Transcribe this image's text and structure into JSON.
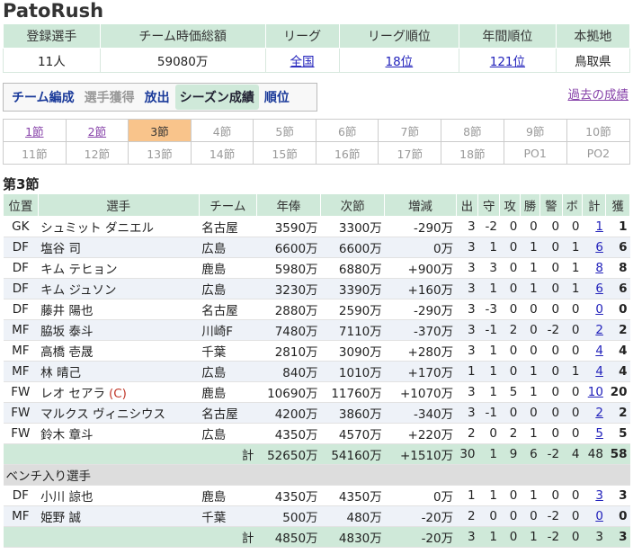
{
  "team_name": "PatoRush",
  "summary": {
    "headers": [
      "登録選手",
      "チーム時価総額",
      "リーグ",
      "リーグ順位",
      "年間順位",
      "本拠地"
    ],
    "values": [
      "11人",
      "59080万",
      "全国",
      "18位",
      "121位",
      "鳥取県"
    ]
  },
  "nav": {
    "items": [
      "チーム編成",
      "選手獲得",
      "放出",
      "シーズン成績",
      "順位"
    ],
    "past_link": "過去の成績"
  },
  "rounds": {
    "row1": [
      "1節",
      "2節",
      "3節",
      "4節",
      "5節",
      "6節",
      "7節",
      "8節",
      "9節",
      "10節"
    ],
    "row2": [
      "11節",
      "12節",
      "13節",
      "14節",
      "15節",
      "16節",
      "17節",
      "18節",
      "PO1",
      "PO2"
    ]
  },
  "section_title": "第3節",
  "table": {
    "headers": [
      "位置",
      "選手",
      "チーム",
      "年俸",
      "次節",
      "増減",
      "出",
      "守",
      "攻",
      "勝",
      "警",
      "ボ",
      "計",
      "獲"
    ],
    "players": [
      {
        "pos": "GK",
        "name": "シュミット ダニエル",
        "cap": "",
        "team": "名古屋",
        "salary": "3590万",
        "next": "3300万",
        "diff": "-290万",
        "de": "3",
        "shu": "-2",
        "kou": "0",
        "sho": "0",
        "kei": "0",
        "bo": "0",
        "kei2": "1",
        "kaku": "1"
      },
      {
        "pos": "DF",
        "name": "塩谷 司",
        "cap": "",
        "team": "広島",
        "salary": "6600万",
        "next": "6600万",
        "diff": "0万",
        "de": "3",
        "shu": "1",
        "kou": "0",
        "sho": "1",
        "kei": "0",
        "bo": "1",
        "kei2": "6",
        "kaku": "6"
      },
      {
        "pos": "DF",
        "name": "キム テヒョン",
        "cap": "",
        "team": "鹿島",
        "salary": "5980万",
        "next": "6880万",
        "diff": "+900万",
        "de": "3",
        "shu": "3",
        "kou": "0",
        "sho": "1",
        "kei": "0",
        "bo": "1",
        "kei2": "8",
        "kaku": "8"
      },
      {
        "pos": "DF",
        "name": "キム ジュソン",
        "cap": "",
        "team": "広島",
        "salary": "3230万",
        "next": "3390万",
        "diff": "+160万",
        "de": "3",
        "shu": "1",
        "kou": "0",
        "sho": "1",
        "kei": "0",
        "bo": "1",
        "kei2": "6",
        "kaku": "6"
      },
      {
        "pos": "DF",
        "name": "藤井 陽也",
        "cap": "",
        "team": "名古屋",
        "salary": "2880万",
        "next": "2590万",
        "diff": "-290万",
        "de": "3",
        "shu": "-3",
        "kou": "0",
        "sho": "0",
        "kei": "0",
        "bo": "0",
        "kei2": "0",
        "kaku": "0"
      },
      {
        "pos": "MF",
        "name": "脇坂 泰斗",
        "cap": "",
        "team": "川崎F",
        "salary": "7480万",
        "next": "7110万",
        "diff": "-370万",
        "de": "3",
        "shu": "-1",
        "kou": "2",
        "sho": "0",
        "kei": "-2",
        "bo": "0",
        "kei2": "2",
        "kaku": "2"
      },
      {
        "pos": "MF",
        "name": "高橋 壱晟",
        "cap": "",
        "team": "千葉",
        "salary": "2810万",
        "next": "3090万",
        "diff": "+280万",
        "de": "3",
        "shu": "1",
        "kou": "0",
        "sho": "0",
        "kei": "0",
        "bo": "0",
        "kei2": "4",
        "kaku": "4"
      },
      {
        "pos": "MF",
        "name": "林 晴己",
        "cap": "",
        "team": "広島",
        "salary": "840万",
        "next": "1010万",
        "diff": "+170万",
        "de": "1",
        "shu": "1",
        "kou": "0",
        "sho": "1",
        "kei": "0",
        "bo": "1",
        "kei2": "4",
        "kaku": "4"
      },
      {
        "pos": "FW",
        "name": "レオ セアラ",
        "cap": "(C)",
        "team": "鹿島",
        "salary": "10690万",
        "next": "11760万",
        "diff": "+1070万",
        "de": "3",
        "shu": "1",
        "kou": "5",
        "sho": "1",
        "kei": "0",
        "bo": "0",
        "kei2": "10",
        "kaku": "20"
      },
      {
        "pos": "FW",
        "name": "マルクス ヴィニシウス",
        "cap": "",
        "team": "名古屋",
        "salary": "4200万",
        "next": "3860万",
        "diff": "-340万",
        "de": "3",
        "shu": "-1",
        "kou": "0",
        "sho": "0",
        "kei": "0",
        "bo": "0",
        "kei2": "2",
        "kaku": "2"
      },
      {
        "pos": "FW",
        "name": "鈴木 章斗",
        "cap": "",
        "team": "広島",
        "salary": "4350万",
        "next": "4570万",
        "diff": "+220万",
        "de": "2",
        "shu": "0",
        "kou": "2",
        "sho": "1",
        "kei": "0",
        "bo": "0",
        "kei2": "5",
        "kaku": "5"
      }
    ],
    "total": {
      "label": "計",
      "salary": "52650万",
      "next": "54160万",
      "diff": "+1510万",
      "de": "30",
      "shu": "1",
      "kou": "9",
      "sho": "6",
      "kei": "-2",
      "bo": "4",
      "kei2": "48",
      "kaku": "58"
    },
    "bench_label": "ベンチ入り選手",
    "bench": [
      {
        "pos": "DF",
        "name": "小川 諒也",
        "cap": "",
        "team": "鹿島",
        "salary": "4350万",
        "next": "4350万",
        "diff": "0万",
        "de": "1",
        "shu": "1",
        "kou": "0",
        "sho": "1",
        "kei": "0",
        "bo": "0",
        "kei2": "3",
        "kaku": "3"
      },
      {
        "pos": "MF",
        "name": "姫野 誠",
        "cap": "",
        "team": "千葉",
        "salary": "500万",
        "next": "480万",
        "diff": "-20万",
        "de": "2",
        "shu": "0",
        "kou": "0",
        "sho": "0",
        "kei": "-2",
        "bo": "0",
        "kei2": "0",
        "kaku": "0"
      }
    ],
    "bench_total": {
      "label": "計",
      "salary": "4850万",
      "next": "4830万",
      "diff": "-20万",
      "de": "3",
      "shu": "1",
      "kou": "0",
      "sho": "1",
      "kei": "-2",
      "bo": "0",
      "kei2": "3",
      "kaku": "3"
    }
  }
}
